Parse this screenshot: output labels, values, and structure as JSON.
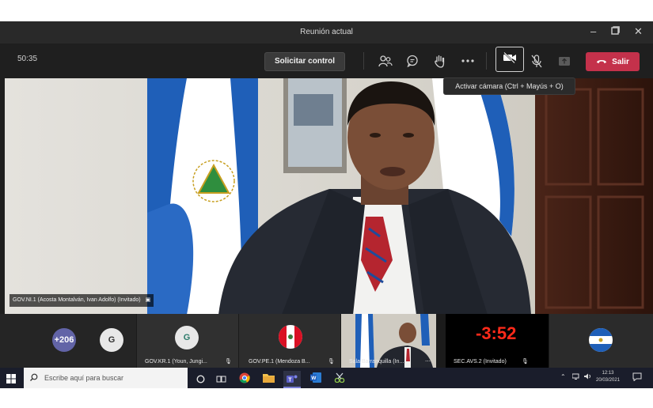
{
  "window": {
    "title": "Reunión actual",
    "controls": [
      "minimize-icon",
      "restore-icon",
      "close-icon"
    ]
  },
  "toolbar": {
    "timer": "50:35",
    "request_control_label": "Solicitar control",
    "icons": [
      "participants-icon",
      "chat-icon",
      "raise-hand-icon",
      "more-options-icon",
      "camera-off-icon",
      "mic-off-icon",
      "share-screen-icon"
    ],
    "leave_label": "Salir",
    "leave_color": "#c4314b"
  },
  "tooltip": {
    "text": "Activar cámara (Ctrl + Mayús + O)"
  },
  "main_video": {
    "participant_label": "GOV.NI.1 (Acosta Montalván, Ivan Adolfo) (Invitado)"
  },
  "participants": {
    "overflow_count": "+206",
    "tiles": [
      {
        "initial": "G",
        "label": ""
      },
      {
        "initial": "G",
        "label": "GOV.KR.1 (Youn, Jungi..."
      },
      {
        "initial": "",
        "label": "GOV.PE.1 (Mendoza B..."
      },
      {
        "initial": "",
        "label": "Sala Barranquilla (In..."
      },
      {
        "initial": "",
        "label": "SEC.AVS.2 (Invitado)"
      },
      {
        "initial": "",
        "label": ""
      }
    ],
    "countdown": "-3:52"
  },
  "taskbar": {
    "search_placeholder": "Escribe aquí para buscar",
    "time": "12:13",
    "date": "20/03/2021"
  }
}
